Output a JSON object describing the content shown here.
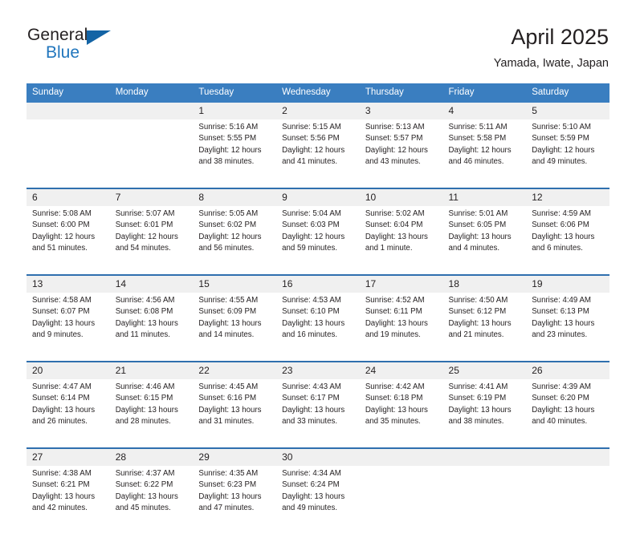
{
  "brand": {
    "name_part1": "General",
    "name_part2": "Blue",
    "flag_icon": "brand-flag-icon"
  },
  "header": {
    "title": "April 2025",
    "subtitle": "Yamada, Iwate, Japan"
  },
  "colors": {
    "header_blue": "#3a7ec0",
    "row_divider_blue": "#2f6fae",
    "daynum_band": "#f0f0f0",
    "brand_blue": "#2176bd",
    "text": "#231f20"
  },
  "weekday_headers": [
    "Sunday",
    "Monday",
    "Tuesday",
    "Wednesday",
    "Thursday",
    "Friday",
    "Saturday"
  ],
  "weeks": [
    {
      "days": [
        {
          "num": "",
          "lines": []
        },
        {
          "num": "",
          "lines": []
        },
        {
          "num": "1",
          "lines": [
            "Sunrise: 5:16 AM",
            "Sunset: 5:55 PM",
            "Daylight: 12 hours",
            "and 38 minutes."
          ]
        },
        {
          "num": "2",
          "lines": [
            "Sunrise: 5:15 AM",
            "Sunset: 5:56 PM",
            "Daylight: 12 hours",
            "and 41 minutes."
          ]
        },
        {
          "num": "3",
          "lines": [
            "Sunrise: 5:13 AM",
            "Sunset: 5:57 PM",
            "Daylight: 12 hours",
            "and 43 minutes."
          ]
        },
        {
          "num": "4",
          "lines": [
            "Sunrise: 5:11 AM",
            "Sunset: 5:58 PM",
            "Daylight: 12 hours",
            "and 46 minutes."
          ]
        },
        {
          "num": "5",
          "lines": [
            "Sunrise: 5:10 AM",
            "Sunset: 5:59 PM",
            "Daylight: 12 hours",
            "and 49 minutes."
          ]
        }
      ]
    },
    {
      "days": [
        {
          "num": "6",
          "lines": [
            "Sunrise: 5:08 AM",
            "Sunset: 6:00 PM",
            "Daylight: 12 hours",
            "and 51 minutes."
          ]
        },
        {
          "num": "7",
          "lines": [
            "Sunrise: 5:07 AM",
            "Sunset: 6:01 PM",
            "Daylight: 12 hours",
            "and 54 minutes."
          ]
        },
        {
          "num": "8",
          "lines": [
            "Sunrise: 5:05 AM",
            "Sunset: 6:02 PM",
            "Daylight: 12 hours",
            "and 56 minutes."
          ]
        },
        {
          "num": "9",
          "lines": [
            "Sunrise: 5:04 AM",
            "Sunset: 6:03 PM",
            "Daylight: 12 hours",
            "and 59 minutes."
          ]
        },
        {
          "num": "10",
          "lines": [
            "Sunrise: 5:02 AM",
            "Sunset: 6:04 PM",
            "Daylight: 13 hours",
            "and 1 minute."
          ]
        },
        {
          "num": "11",
          "lines": [
            "Sunrise: 5:01 AM",
            "Sunset: 6:05 PM",
            "Daylight: 13 hours",
            "and 4 minutes."
          ]
        },
        {
          "num": "12",
          "lines": [
            "Sunrise: 4:59 AM",
            "Sunset: 6:06 PM",
            "Daylight: 13 hours",
            "and 6 minutes."
          ]
        }
      ]
    },
    {
      "days": [
        {
          "num": "13",
          "lines": [
            "Sunrise: 4:58 AM",
            "Sunset: 6:07 PM",
            "Daylight: 13 hours",
            "and 9 minutes."
          ]
        },
        {
          "num": "14",
          "lines": [
            "Sunrise: 4:56 AM",
            "Sunset: 6:08 PM",
            "Daylight: 13 hours",
            "and 11 minutes."
          ]
        },
        {
          "num": "15",
          "lines": [
            "Sunrise: 4:55 AM",
            "Sunset: 6:09 PM",
            "Daylight: 13 hours",
            "and 14 minutes."
          ]
        },
        {
          "num": "16",
          "lines": [
            "Sunrise: 4:53 AM",
            "Sunset: 6:10 PM",
            "Daylight: 13 hours",
            "and 16 minutes."
          ]
        },
        {
          "num": "17",
          "lines": [
            "Sunrise: 4:52 AM",
            "Sunset: 6:11 PM",
            "Daylight: 13 hours",
            "and 19 minutes."
          ]
        },
        {
          "num": "18",
          "lines": [
            "Sunrise: 4:50 AM",
            "Sunset: 6:12 PM",
            "Daylight: 13 hours",
            "and 21 minutes."
          ]
        },
        {
          "num": "19",
          "lines": [
            "Sunrise: 4:49 AM",
            "Sunset: 6:13 PM",
            "Daylight: 13 hours",
            "and 23 minutes."
          ]
        }
      ]
    },
    {
      "days": [
        {
          "num": "20",
          "lines": [
            "Sunrise: 4:47 AM",
            "Sunset: 6:14 PM",
            "Daylight: 13 hours",
            "and 26 minutes."
          ]
        },
        {
          "num": "21",
          "lines": [
            "Sunrise: 4:46 AM",
            "Sunset: 6:15 PM",
            "Daylight: 13 hours",
            "and 28 minutes."
          ]
        },
        {
          "num": "22",
          "lines": [
            "Sunrise: 4:45 AM",
            "Sunset: 6:16 PM",
            "Daylight: 13 hours",
            "and 31 minutes."
          ]
        },
        {
          "num": "23",
          "lines": [
            "Sunrise: 4:43 AM",
            "Sunset: 6:17 PM",
            "Daylight: 13 hours",
            "and 33 minutes."
          ]
        },
        {
          "num": "24",
          "lines": [
            "Sunrise: 4:42 AM",
            "Sunset: 6:18 PM",
            "Daylight: 13 hours",
            "and 35 minutes."
          ]
        },
        {
          "num": "25",
          "lines": [
            "Sunrise: 4:41 AM",
            "Sunset: 6:19 PM",
            "Daylight: 13 hours",
            "and 38 minutes."
          ]
        },
        {
          "num": "26",
          "lines": [
            "Sunrise: 4:39 AM",
            "Sunset: 6:20 PM",
            "Daylight: 13 hours",
            "and 40 minutes."
          ]
        }
      ]
    },
    {
      "days": [
        {
          "num": "27",
          "lines": [
            "Sunrise: 4:38 AM",
            "Sunset: 6:21 PM",
            "Daylight: 13 hours",
            "and 42 minutes."
          ]
        },
        {
          "num": "28",
          "lines": [
            "Sunrise: 4:37 AM",
            "Sunset: 6:22 PM",
            "Daylight: 13 hours",
            "and 45 minutes."
          ]
        },
        {
          "num": "29",
          "lines": [
            "Sunrise: 4:35 AM",
            "Sunset: 6:23 PM",
            "Daylight: 13 hours",
            "and 47 minutes."
          ]
        },
        {
          "num": "30",
          "lines": [
            "Sunrise: 4:34 AM",
            "Sunset: 6:24 PM",
            "Daylight: 13 hours",
            "and 49 minutes."
          ]
        },
        {
          "num": "",
          "lines": []
        },
        {
          "num": "",
          "lines": []
        },
        {
          "num": "",
          "lines": []
        }
      ]
    }
  ]
}
